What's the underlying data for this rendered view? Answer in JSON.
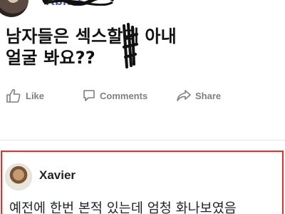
{
  "post": {
    "author_name": "Kbh..s",
    "text_line1": "남자들은 섹스할때 아내",
    "text_line2": "얼굴 봐요??"
  },
  "actions": {
    "like": "Like",
    "comments": "Comments",
    "share": "Share"
  },
  "comment": {
    "author": "Xavier",
    "text": "예전에 한번 본적 있는데 엄청 화나보였음"
  },
  "colors": {
    "link_blue": "#365899",
    "action_gray": "#7f7f7f",
    "highlight_red": "#e0312b"
  },
  "icons": [
    "thumbs-up-icon",
    "comment-bubble-icon",
    "share-arrow-icon",
    "profile-avatar-icon"
  ]
}
